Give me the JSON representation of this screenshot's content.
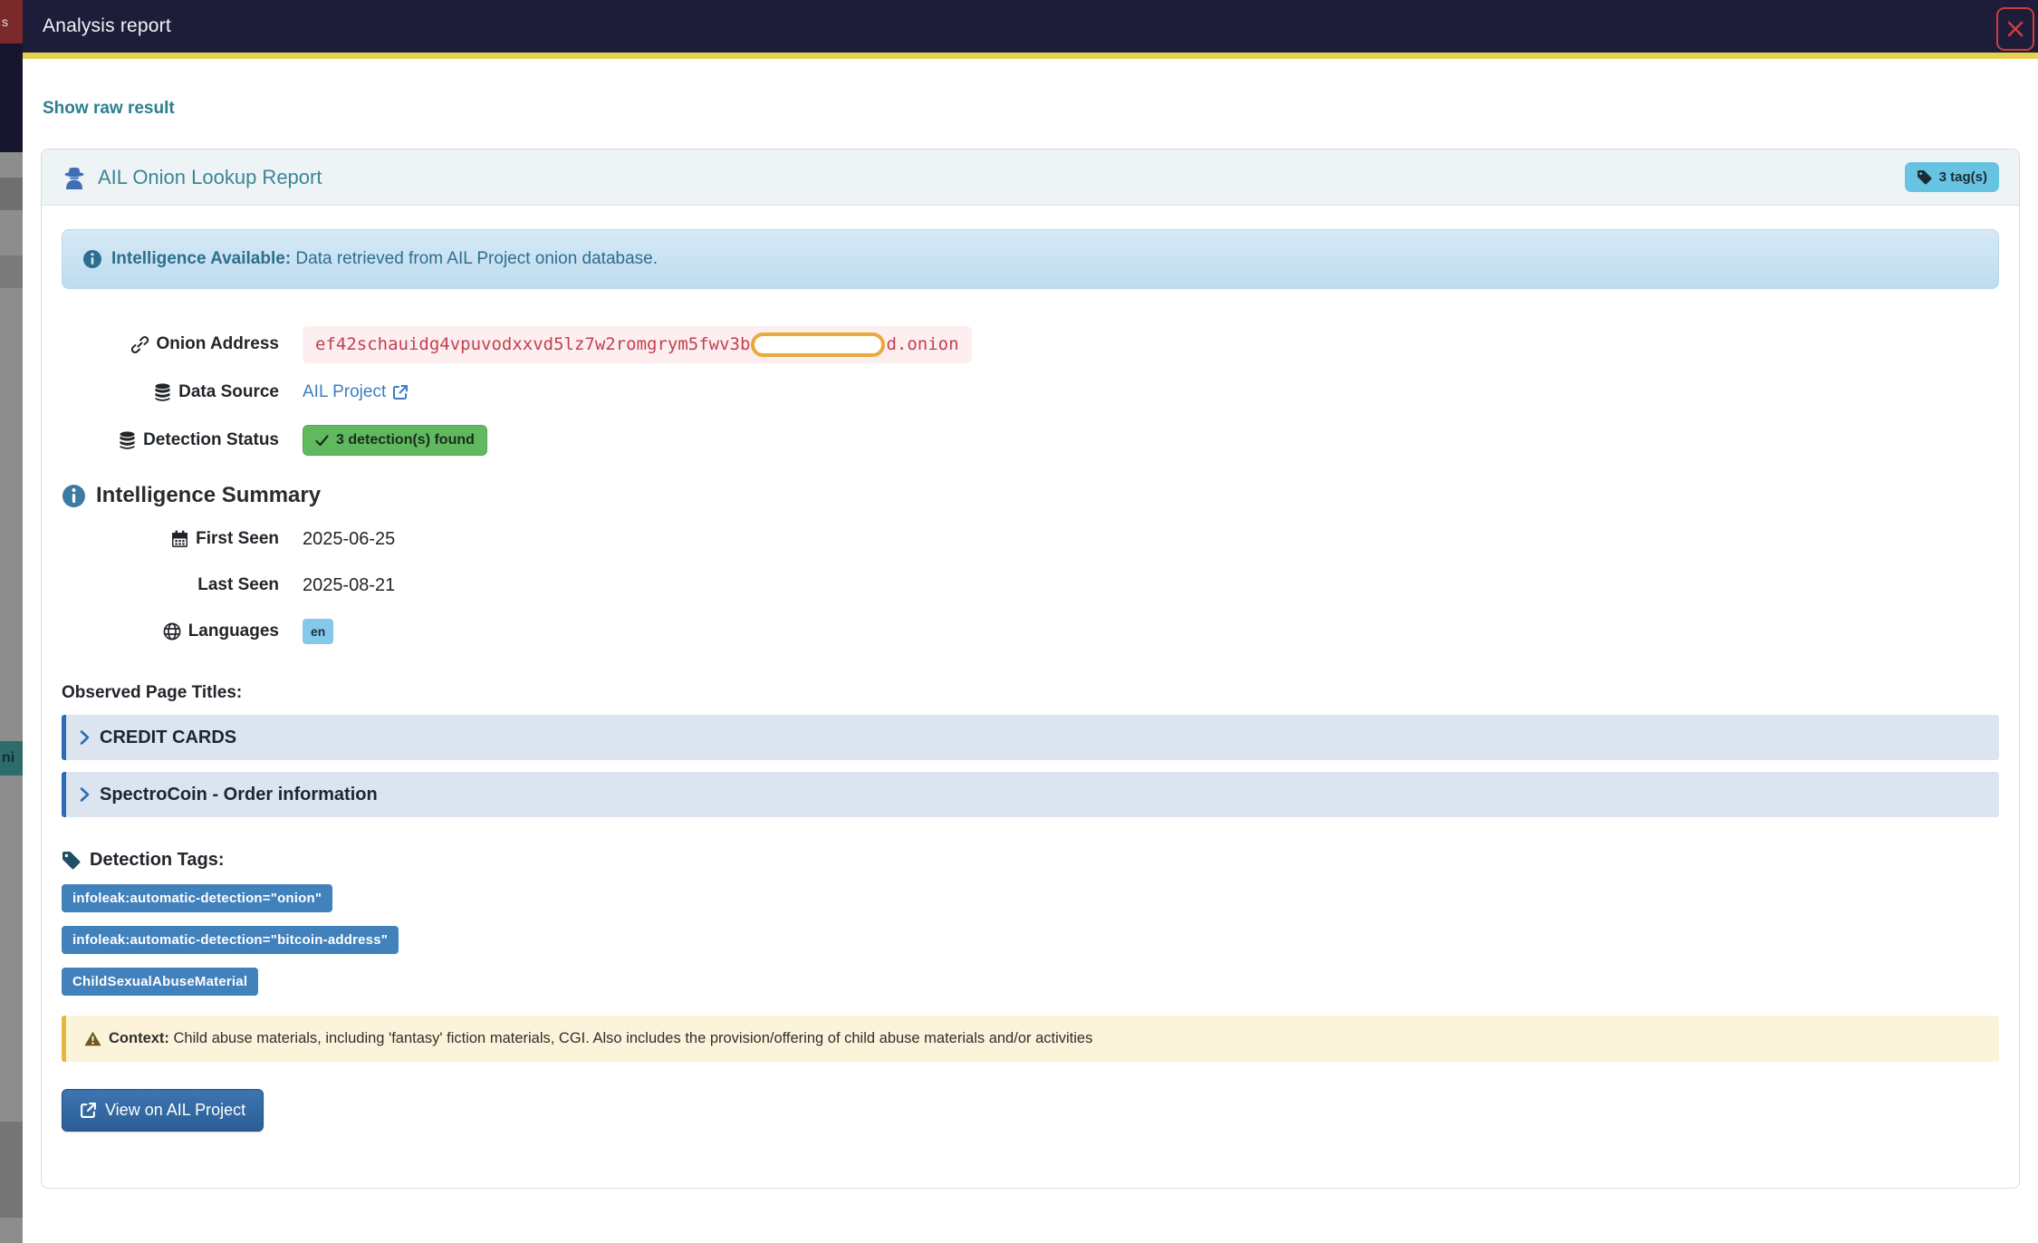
{
  "modal": {
    "title": "Analysis report"
  },
  "actions": {
    "show_raw": "Show raw result"
  },
  "report": {
    "title": "AIL Onion Lookup Report",
    "tags_badge": "3 tag(s)",
    "alert": {
      "bold": "Intelligence Available:",
      "text": " Data retrieved from AIL Project onion database."
    },
    "fields": {
      "onion": {
        "label": "Onion Address",
        "value_prefix": "ef42schauidg4vpuvodxxvd5lz7w2romgrym5fwv3b",
        "value_suffix": "d.onion"
      },
      "source": {
        "label": "Data Source",
        "value": "AIL Project"
      },
      "status": {
        "label": "Detection Status",
        "badge": "3 detection(s) found"
      }
    },
    "summary": {
      "heading": "Intelligence Summary",
      "first_seen": {
        "label": "First Seen",
        "value": "2025-06-25"
      },
      "last_seen": {
        "label": "Last Seen",
        "value": "2025-08-21"
      },
      "languages": {
        "label": "Languages",
        "badge": "en"
      }
    },
    "observed": {
      "heading": "Observed Page Titles:",
      "titles": [
        "CREDIT CARDS",
        "SpectroCoin - Order information"
      ]
    },
    "tags": {
      "heading": "Detection Tags:",
      "items": [
        "infoleak:automatic-detection=\"onion\"",
        "infoleak:automatic-detection=\"bitcoin-address\"",
        "ChildSexualAbuseMaterial"
      ]
    },
    "context": {
      "bold": "Context:",
      "text": " Child abuse materials, including 'fantasy' fiction materials, CGI. Also includes the provision/offering of child abuse materials and/or activities"
    },
    "view_button": "View on AIL Project"
  },
  "backdrop": {
    "fragment_red": "s",
    "fragment_teal": "ni"
  },
  "colors": {
    "header_bg": "#1e1d39",
    "accent_yellow": "#e6d14f",
    "teal_link": "#2b7f91",
    "info_alert_bg": "#c9e2f3",
    "onion_text": "#c5404e",
    "redaction_border": "#e9a93d",
    "success_badge": "#5fb95e",
    "tag_pill": "#4181bc",
    "warning_bg": "#fcf4da",
    "button_blue": "#2f66a0",
    "close_red": "#cf3c3c"
  }
}
